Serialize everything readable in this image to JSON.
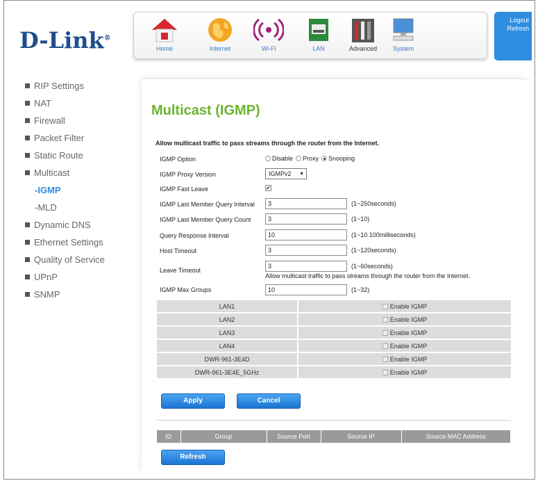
{
  "brand": {
    "name": "D-Link",
    "mark": "®"
  },
  "nav": [
    {
      "label": "Home",
      "icon": "home-icon"
    },
    {
      "label": "Internet",
      "icon": "globe-icon"
    },
    {
      "label": "Wi-Fi",
      "icon": "wifi-icon"
    },
    {
      "label": "LAN",
      "icon": "lan-icon"
    },
    {
      "label": "Advanced",
      "icon": "tools-icon"
    },
    {
      "label": "System",
      "icon": "computer-icon"
    }
  ],
  "account": {
    "logout": "Logout",
    "refresh": "Refresh"
  },
  "sidebar": {
    "items": [
      {
        "label": "RIP Settings"
      },
      {
        "label": "NAT"
      },
      {
        "label": "Firewall"
      },
      {
        "label": "Packet Filter"
      },
      {
        "label": "Static Route"
      },
      {
        "label": "Multicast"
      },
      {
        "label": "-IGMP"
      },
      {
        "label": "-MLD"
      },
      {
        "label": "Dynamic DNS"
      },
      {
        "label": "Ethernet Settings"
      },
      {
        "label": "Quality of Service"
      },
      {
        "label": "UPnP"
      },
      {
        "label": "SNMP"
      }
    ]
  },
  "page": {
    "title": "Multicast (IGMP)",
    "intro": "Allow multicast traffic to pass streams through the router from the Internet."
  },
  "form": {
    "igmp_option": {
      "label": "IGMP Option",
      "options": [
        "Disable",
        "Proxy",
        "Snooping"
      ],
      "selected": "Snooping"
    },
    "proxy_version": {
      "label": "IGMP Proxy Version",
      "value": "IGMPv2"
    },
    "fast_leave": {
      "label": "IGMP Fast Leave",
      "checked": "✔"
    },
    "last_member_interval": {
      "label": "IGMP Last Member Query Interval",
      "value": "3",
      "hint": "(1~250seconds)"
    },
    "last_member_count": {
      "label": "IGMP Last Member Query Count",
      "value": "3",
      "hint": "(1~10)"
    },
    "query_response": {
      "label": "Query Response Interval",
      "value": "10",
      "hint": "(1~10 100milliseconds)"
    },
    "host_timeout": {
      "label": "Host Timeout",
      "value": "3",
      "hint": "(1~120seconds)"
    },
    "leave_timeout": {
      "label": "Leave Timeout",
      "value": "3",
      "hint": "(1~60seconds)",
      "note": "Allow multicast traffic to pass streams through the router from the Internet."
    },
    "max_groups": {
      "label": "IGMP Max Groups",
      "value": "10",
      "hint": "(1~32)"
    }
  },
  "lan_table": {
    "rows": [
      {
        "name": "LAN1",
        "option": "Enable IGMP"
      },
      {
        "name": "LAN2",
        "option": "Enable IGMP"
      },
      {
        "name": "LAN3",
        "option": "Enable IGMP"
      },
      {
        "name": "LAN4",
        "option": "Enable IGMP"
      },
      {
        "name": "DWR-961-3E4D",
        "option": "Enable IGMP"
      },
      {
        "name": "DWR-961-3E4E_5GHz",
        "option": "Enable IGMP"
      }
    ]
  },
  "buttons": {
    "apply": "Apply",
    "cancel": "Cancel",
    "refresh": "Refresh"
  },
  "group_table": {
    "headers": [
      "ID",
      "Group",
      "Source Port",
      "Source IP",
      "Source MAC Address"
    ]
  }
}
